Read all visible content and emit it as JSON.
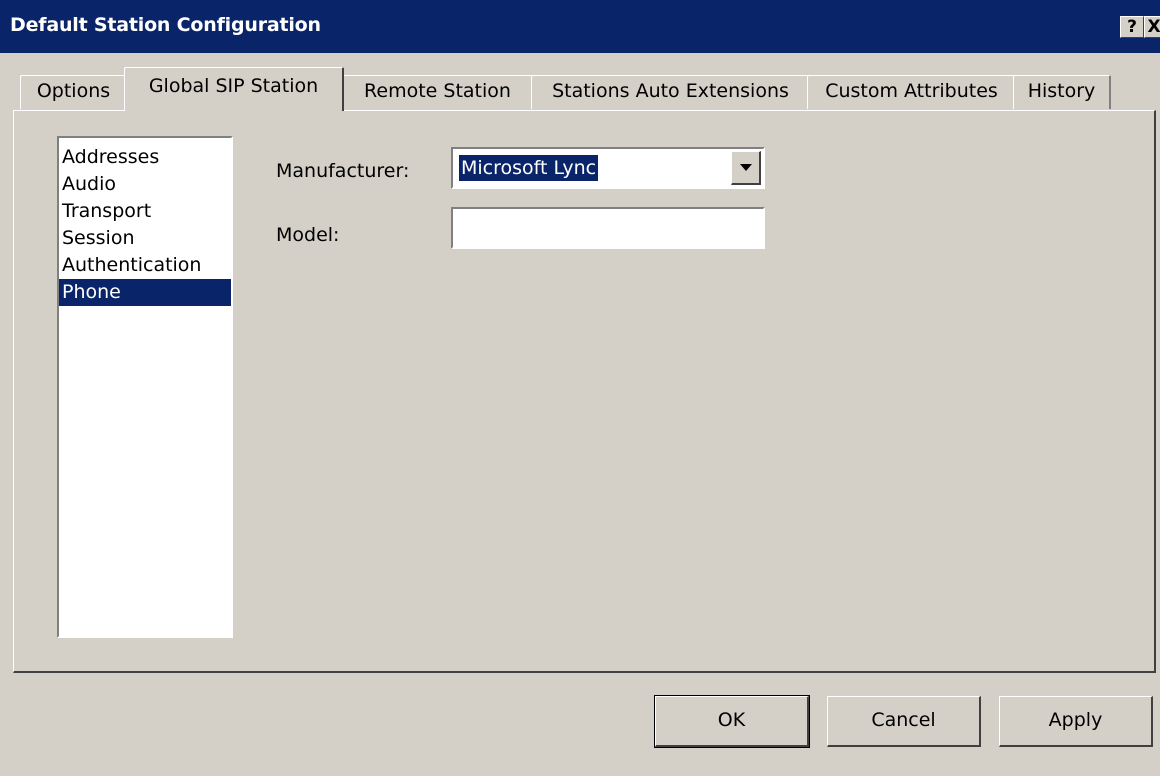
{
  "window": {
    "title": "Default Station Configuration",
    "help_glyph": "?",
    "close_glyph": "X"
  },
  "tabs": [
    {
      "label": "Options"
    },
    {
      "label": "Global SIP Station"
    },
    {
      "label": "Remote Station"
    },
    {
      "label": "Stations Auto Extensions"
    },
    {
      "label": "Custom Attributes"
    },
    {
      "label": "History"
    }
  ],
  "active_tab": "Global SIP Station",
  "categories": {
    "items": [
      {
        "label": "Addresses"
      },
      {
        "label": "Audio"
      },
      {
        "label": "Transport"
      },
      {
        "label": "Session"
      },
      {
        "label": "Authentication"
      },
      {
        "label": "Phone"
      }
    ],
    "selected": "Phone"
  },
  "form": {
    "manufacturer_label": "Manufacturer:",
    "manufacturer_value": "Microsoft Lync",
    "model_label": "Model:",
    "model_value": ""
  },
  "buttons": {
    "ok": "OK",
    "cancel": "Cancel",
    "apply": "Apply"
  },
  "colors": {
    "titlebar": "#0a246a",
    "face": "#d4d0c8",
    "selection": "#0a246a"
  },
  "icons": {
    "dropdown": "chevron-down-icon"
  }
}
